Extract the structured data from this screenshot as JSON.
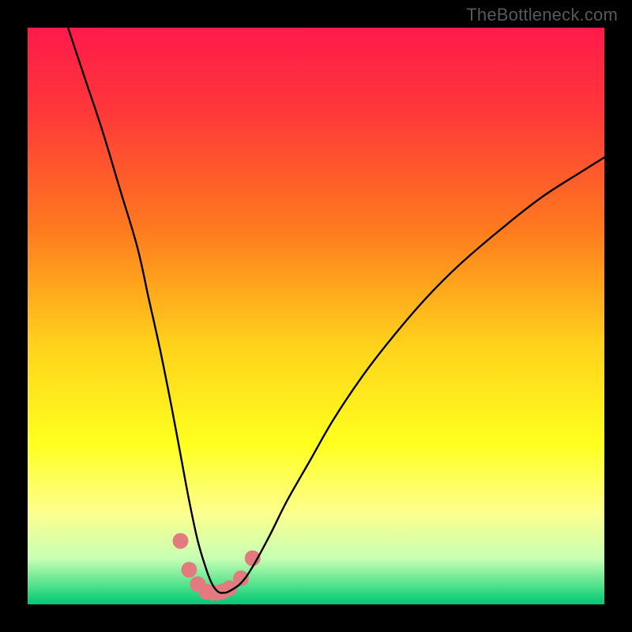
{
  "watermark": {
    "text": "TheBottleneck.com"
  },
  "chart_data": {
    "type": "line",
    "title": "",
    "xlabel": "",
    "ylabel": "",
    "xlim": [
      0,
      100
    ],
    "ylim": [
      0,
      100
    ],
    "background_gradient_stops": [
      {
        "offset": 0.0,
        "color": "#ff1a4b"
      },
      {
        "offset": 0.15,
        "color": "#ff3939"
      },
      {
        "offset": 0.35,
        "color": "#ff7a1e"
      },
      {
        "offset": 0.55,
        "color": "#ffd21c"
      },
      {
        "offset": 0.72,
        "color": "#ffff1e"
      },
      {
        "offset": 0.84,
        "color": "#fdff8d"
      },
      {
        "offset": 0.92,
        "color": "#c8ffb4"
      },
      {
        "offset": 0.965,
        "color": "#57e38d"
      },
      {
        "offset": 1.0,
        "color": "#00c776"
      }
    ],
    "series": [
      {
        "name": "bottleneck-curve",
        "type": "line",
        "x": [
          7,
          10,
          13,
          16,
          19,
          21,
          23,
          25,
          26.5,
          28,
          29.5,
          31,
          32,
          33,
          34,
          35,
          37,
          39,
          42,
          45,
          49,
          53,
          58,
          63,
          69,
          75,
          82,
          89,
          96,
          100
        ],
        "y": [
          100,
          91,
          82,
          72,
          62,
          53,
          44,
          34,
          26,
          18,
          11,
          6,
          3.5,
          2.2,
          2,
          2.3,
          3.7,
          6.5,
          12,
          18,
          25,
          32,
          39.5,
          46,
          53,
          59,
          65,
          70.5,
          75,
          77.5
        ]
      },
      {
        "name": "trough-markers",
        "type": "scatter",
        "x": [
          26.5,
          28,
          29.5,
          31,
          32,
          33,
          34,
          35,
          37,
          39
        ],
        "y": [
          11,
          6,
          3.5,
          2.2,
          2,
          2,
          2.3,
          2.8,
          4.5,
          8
        ],
        "marker_color": "#e27b7f",
        "marker_radius": 10
      }
    ]
  }
}
